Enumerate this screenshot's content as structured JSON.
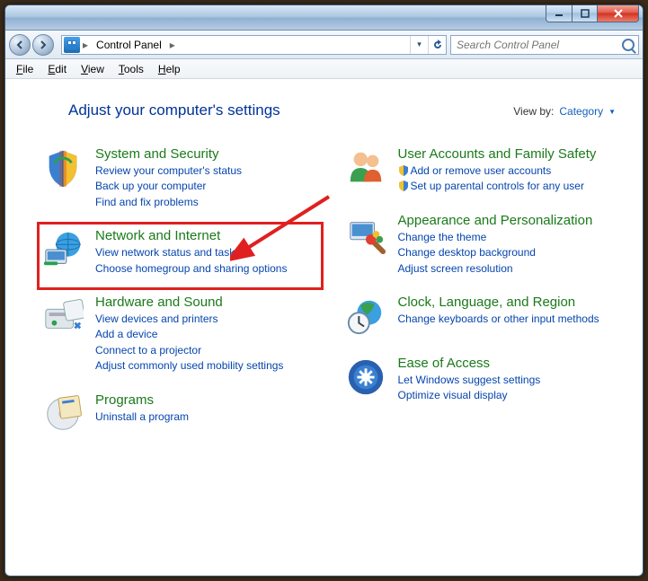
{
  "title": "Control Panel",
  "search_placeholder": "Search Control Panel",
  "menu": [
    "File",
    "Edit",
    "View",
    "Tools",
    "Help"
  ],
  "heading": "Adjust your computer's settings",
  "viewby_label": "View by:",
  "viewby_value": "Category",
  "breadcrumb": [
    "Control Panel"
  ],
  "columns": [
    [
      {
        "title": "System and Security",
        "links": [
          "Review your computer's status",
          "Back up your computer",
          "Find and fix problems"
        ],
        "shield": []
      },
      {
        "title": "Network and Internet",
        "highlight": true,
        "links": [
          "View network status and tasks",
          "Choose homegroup and sharing options"
        ],
        "shield": []
      },
      {
        "title": "Hardware and Sound",
        "links": [
          "View devices and printers",
          "Add a device",
          "Connect to a projector",
          "Adjust commonly used mobility settings"
        ],
        "shield": []
      },
      {
        "title": "Programs",
        "links": [
          "Uninstall a program"
        ],
        "shield": []
      }
    ],
    [
      {
        "title": "User Accounts and Family Safety",
        "links": [
          "Add or remove user accounts",
          "Set up parental controls for any user"
        ],
        "shield": [
          0,
          1
        ]
      },
      {
        "title": "Appearance and Personalization",
        "links": [
          "Change the theme",
          "Change desktop background",
          "Adjust screen resolution"
        ],
        "shield": []
      },
      {
        "title": "Clock, Language, and Region",
        "links": [
          "Change keyboards or other input methods"
        ],
        "shield": []
      },
      {
        "title": "Ease of Access",
        "links": [
          "Let Windows suggest settings",
          "Optimize visual display"
        ],
        "shield": []
      }
    ]
  ]
}
